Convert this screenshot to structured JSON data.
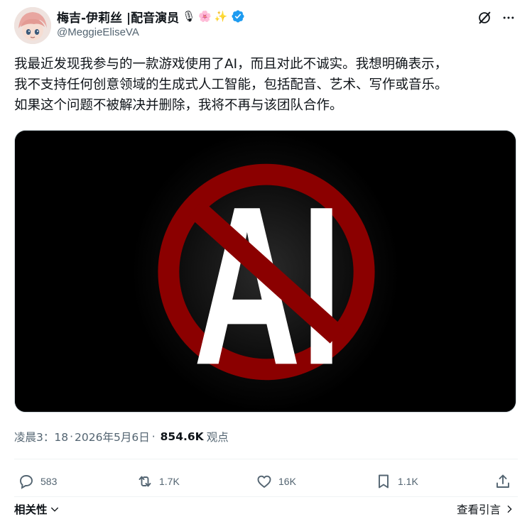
{
  "author": {
    "display_name": "梅吉-伊莉丝 |配音演员",
    "badges": [
      "🎙",
      "🌸",
      "✨"
    ],
    "handle": "@MeggieEliseVA",
    "verified": true,
    "avatar_icon": "anime-avatar"
  },
  "header_icons": [
    "grok-icon",
    "more-icon"
  ],
  "tweet": {
    "lines": [
      "我最近发现我参与的一款游戏使用了AI，而且对此不诚实。我想明确表示，",
      "我不支持任何创意领域的生成式人工智能，包括配音、艺术、写作或音乐。",
      "如果这个问题不被解决并删除，我将不再与该团队合作。"
    ]
  },
  "media": {
    "text": "AI",
    "symbol": "prohibition-sign",
    "colors": {
      "background": "#000000",
      "letters": "#ffffff",
      "ring": "#8b0000"
    }
  },
  "meta": {
    "time": "凌晨3：18",
    "separator": "·",
    "date": "2026年5月6日",
    "views_count": "854.6K",
    "views_label": "观点"
  },
  "actions": {
    "replies": "583",
    "reposts": "1.7K",
    "likes": "16K",
    "bookmarks": "1.1K"
  },
  "footer": {
    "related": "相关性",
    "quotes": "查看引言"
  },
  "colors": {
    "accent": "#1d9bf0",
    "secondary_text": "#536471",
    "primary_text": "#0f1419"
  }
}
